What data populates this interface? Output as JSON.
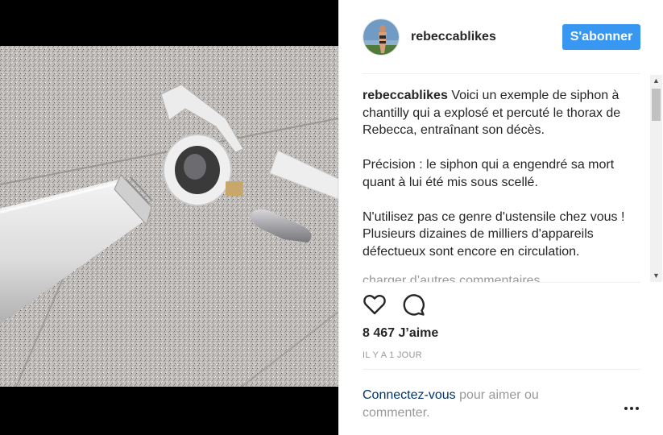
{
  "post": {
    "username": "rebeccablikes",
    "follow_label": "S'abonner",
    "caption": {
      "username": "rebeccablikes",
      "paragraphs": [
        "Voici un exemple de siphon à chantilly qui a explosé et percuté le thorax de Rebecca, entraînant son décès.",
        "Précision : le siphon qui a engendré sa mort quant à lui été mis sous scellé.",
        "N'utilisez pas ce genre d'ustensile chez vous ! Plusieurs dizaines de milliers d'appareils défectueux sont encore en circulation."
      ]
    },
    "load_more_comments": "charger d’autres commentaires",
    "likes": "8 467 J’aime",
    "timestamp": "IL Y A 1 JOUR",
    "login_prompt": {
      "link": "Connectez-vous",
      "text": " pour aimer ou commenter."
    },
    "icons": {
      "like": "heart-icon",
      "comment": "comment-bubble-icon",
      "more": "ellipsis-icon"
    },
    "colors": {
      "follow_button": "#3897f0",
      "login_link": "#003569",
      "muted_text": "#999999"
    }
  }
}
